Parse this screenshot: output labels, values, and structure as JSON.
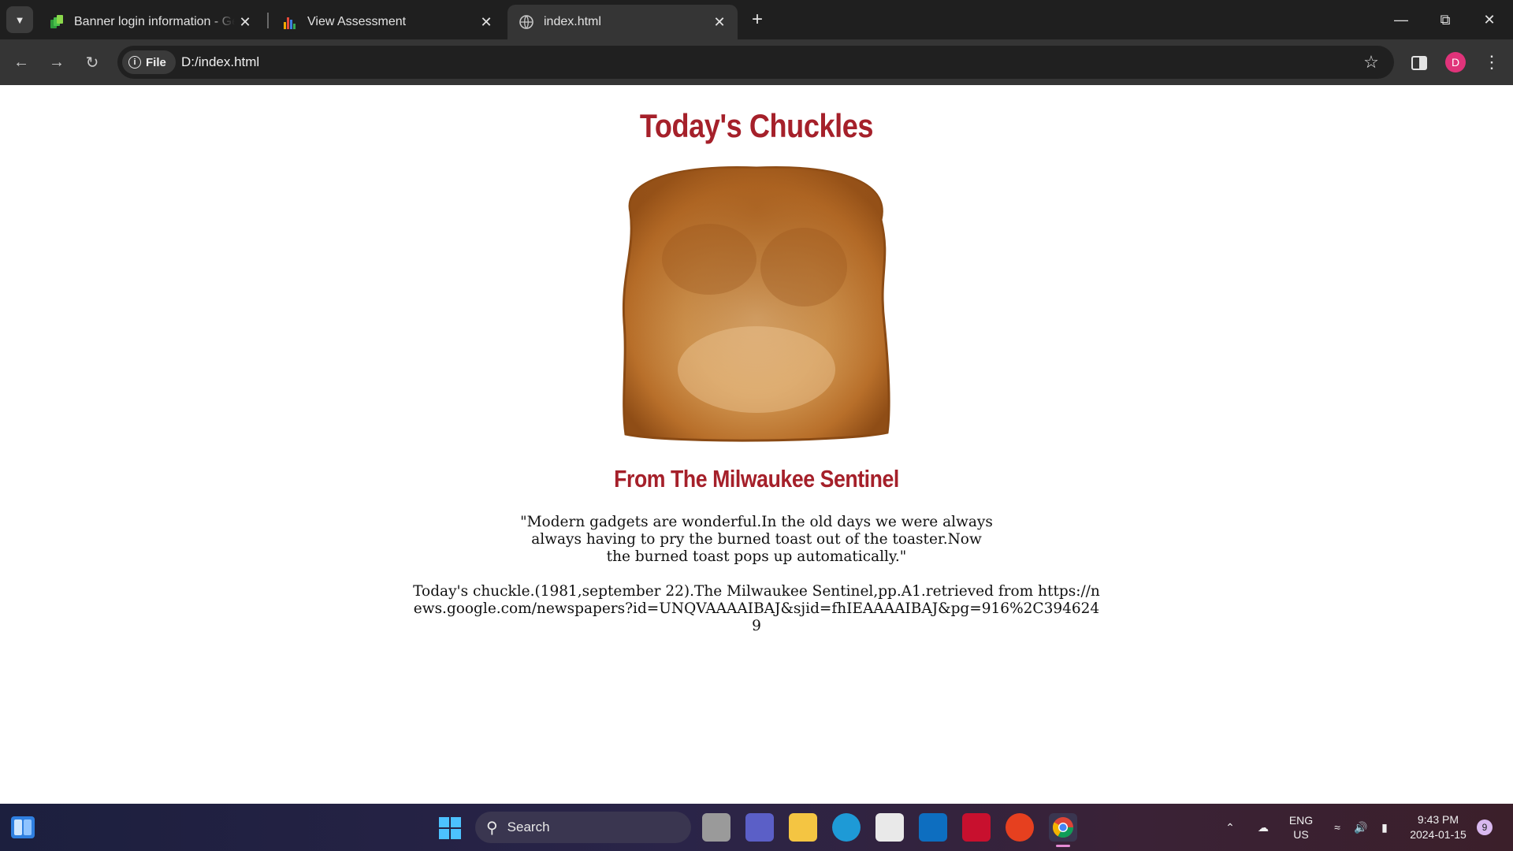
{
  "browser": {
    "tabs": [
      {
        "title": "Banner login information - Geo",
        "favicon": "geo-icon"
      },
      {
        "title": "View Assessment",
        "favicon": "bar-chart-icon"
      },
      {
        "title": "index.html",
        "favicon": "globe-icon",
        "active": true
      }
    ],
    "address": {
      "scheme_chip": "File",
      "url": "D:/index.html"
    },
    "profile_initial": "D"
  },
  "page": {
    "title": "Today's Chuckles",
    "image": "toast-image",
    "subtitle": "From The Milwaukee Sentinel",
    "quote": "\"Modern gadgets are wonderful.In the old days we were always always having to pry the burned toast out of the toaster.Now the burned toast pops up automatically.\"",
    "citation": "Today's chuckle.(1981,september 22).The Milwaukee Sentinel,pp.A1.retrieved from https://news.google.com/newspapers?id=UNQVAAAAIBAJ&sjid=fhIEAAAAIBAJ&pg=916%2C3946249"
  },
  "taskbar": {
    "search_label": "Search",
    "language": "ENG",
    "region": "US",
    "time": "9:43 PM",
    "date": "2024-01-15",
    "notification_count": "9"
  },
  "colors": {
    "heading": "#a5202a",
    "tab_bar": "#1f1f1f",
    "toolbar": "#353535"
  }
}
